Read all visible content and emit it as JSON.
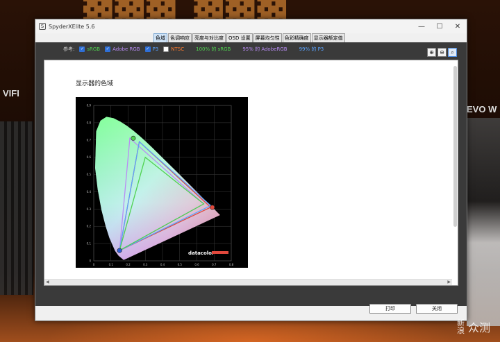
{
  "window": {
    "title": "SpyderXElite 5.6",
    "icon": "S"
  },
  "tabs": [
    {
      "label": "色域",
      "active": true
    },
    {
      "label": "色调响应",
      "active": false
    },
    {
      "label": "亮度与对比度",
      "active": false
    },
    {
      "label": "OSD 设置",
      "active": false
    },
    {
      "label": "屏幕均匀性",
      "active": false
    },
    {
      "label": "色彩精确度",
      "active": false
    },
    {
      "label": "显示器额定值",
      "active": false
    }
  ],
  "reference": {
    "label": "参考:",
    "items": [
      {
        "label": "sRGB",
        "checked": true,
        "color": "#4fd24f"
      },
      {
        "label": "Adobe RGB",
        "checked": true,
        "color": "#b98cf5"
      },
      {
        "label": "P3",
        "checked": true,
        "color": "#5aa3ff"
      },
      {
        "label": "NTSC",
        "checked": false,
        "color": "#ff7b2e"
      }
    ],
    "stats": [
      {
        "text": "100% 的 sRGB",
        "color": "#4fd24f"
      },
      {
        "text": "95% 的 AdobeRGB",
        "color": "#b98cf5"
      },
      {
        "text": "99% 的 P3",
        "color": "#5aa3ff"
      }
    ]
  },
  "zoom": [
    "zoom-in-icon",
    "zoom-out-icon",
    "zoom-fit-icon"
  ],
  "panel": {
    "title": "显示器的色域"
  },
  "chart_data": {
    "type": "scatter",
    "title": "",
    "xlim": [
      0,
      0.8
    ],
    "ylim": [
      0,
      0.9
    ],
    "x_ticks": [
      "0",
      "0.1",
      "0.2",
      "0.3",
      "0.4",
      "0.5",
      "0.6",
      "0.7",
      "0.8"
    ],
    "y_ticks": [
      "0",
      "0.1",
      "0.2",
      "0.3",
      "0.4",
      "0.5",
      "0.6",
      "0.7",
      "0.8",
      "0.9"
    ],
    "grid": true,
    "brand": "datacolor",
    "series": [
      {
        "points": [
          [
            0.68,
            0.31
          ],
          [
            0.265,
            0.69
          ],
          [
            0.15,
            0.06
          ]
        ],
        "color": "#e0483c"
      },
      {
        "points": [
          [
            0.64,
            0.33
          ],
          [
            0.21,
            0.71
          ],
          [
            0.15,
            0.06
          ]
        ],
        "color": "#b98cf5"
      },
      {
        "points": [
          [
            0.68,
            0.32
          ],
          [
            0.265,
            0.69
          ],
          [
            0.15,
            0.06
          ]
        ],
        "color": "#5aa3ff"
      },
      {
        "points": [
          [
            0.64,
            0.33
          ],
          [
            0.3,
            0.6
          ],
          [
            0.15,
            0.06
          ]
        ],
        "color": "#4fd24f"
      }
    ],
    "markers": [
      {
        "x": 0.69,
        "y": 0.31,
        "color": "#e0483c"
      },
      {
        "x": 0.23,
        "y": 0.71,
        "color": "#4fd24f"
      },
      {
        "x": 0.15,
        "y": 0.06,
        "color": "#2f5fd6"
      }
    ]
  },
  "buttons": {
    "print": "打印",
    "close": "关闭"
  },
  "background": {
    "left_text": "VIFI",
    "right_text": "EVO W"
  },
  "watermark": {
    "stack": "新浪",
    "text": "众测"
  }
}
